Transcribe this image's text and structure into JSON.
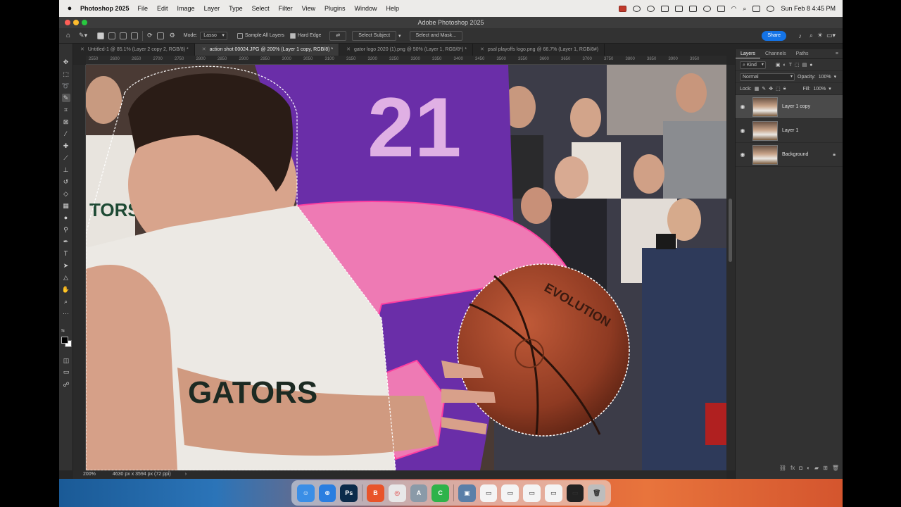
{
  "menubar": {
    "app_name": "Photoshop 2025",
    "items": [
      "File",
      "Edit",
      "Image",
      "Layer",
      "Type",
      "Select",
      "Filter",
      "View",
      "Plugins",
      "Window",
      "Help"
    ],
    "clock": "Sun Feb 8  4:45 PM"
  },
  "window": {
    "title": "Adobe Photoshop 2025"
  },
  "options": {
    "mode_label": "Mode:",
    "mode_value": "Lasso",
    "sample_all_layers": "Sample All Layers",
    "hard_edge": "Hard Edge",
    "select_subject": "Select Subject",
    "select_and_mask": "Select and Mask...",
    "share": "Share"
  },
  "tabs": [
    {
      "label": "Untitled-1 @ 85.1% (Layer 2 copy 2, RGB/8) *",
      "active": false
    },
    {
      "label": "action shot 00024.JPG @ 200% (Layer 1 copy, RGB/8) *",
      "active": true
    },
    {
      "label": "gator logo 2020 (1).png @ 50% (Layer 1, RGB/8*) *",
      "active": false
    },
    {
      "label": "psal playoffs logo.png @ 66.7% (Layer 1, RGB/8#)",
      "active": false
    }
  ],
  "ruler": {
    "top_ticks": [
      "2550",
      "2600",
      "2650",
      "2700",
      "2750",
      "2800",
      "2850",
      "2900",
      "2950",
      "3000",
      "3050",
      "3100",
      "3150",
      "3200",
      "3250",
      "3300",
      "3350",
      "3400",
      "3450",
      "3500",
      "3550",
      "3600",
      "3650",
      "3700",
      "3750",
      "3800",
      "3850",
      "3900",
      "3950"
    ]
  },
  "status": {
    "zoom": "200%",
    "doc_size": "4630 px x 3594 px (72 ppi)"
  },
  "panel": {
    "tabs": [
      "Layers",
      "Channels",
      "Paths"
    ],
    "filter_kind": "Kind",
    "blend_mode": "Normal",
    "opacity_label": "Opacity:",
    "opacity_value": "100%",
    "lock_label": "Lock:",
    "fill_label": "Fill:",
    "fill_value": "100%",
    "layers": [
      {
        "name": "Layer 1 copy",
        "active": true
      },
      {
        "name": "Layer 1",
        "active": false
      },
      {
        "name": "Background",
        "active": false
      }
    ]
  },
  "canvas": {
    "jersey_number": "21",
    "shirt_text": "GATORS",
    "ball_brand": "EVOLUTION",
    "bg_shirt_text": "TORS"
  },
  "dock": {
    "apps": [
      {
        "label": "☺",
        "color": "#3a8ee6",
        "name": "finder-app"
      },
      {
        "label": "⊕",
        "color": "#2a7ee0",
        "name": "safari-app"
      },
      {
        "label": "Ps",
        "color": "#0b2b4a",
        "name": "photoshop-app"
      },
      {
        "label": "B",
        "color": "#e8542a",
        "name": "brave-app"
      },
      {
        "label": "◎",
        "color": "#e8e8e8",
        "name": "chrome-app"
      },
      {
        "label": "A",
        "color": "#8a9aa8",
        "name": "font-book-app"
      },
      {
        "label": "C",
        "color": "#2eb34a",
        "name": "facetime-app"
      },
      {
        "label": "▣",
        "color": "#5a7fa8",
        "name": "preview-app"
      }
    ]
  }
}
